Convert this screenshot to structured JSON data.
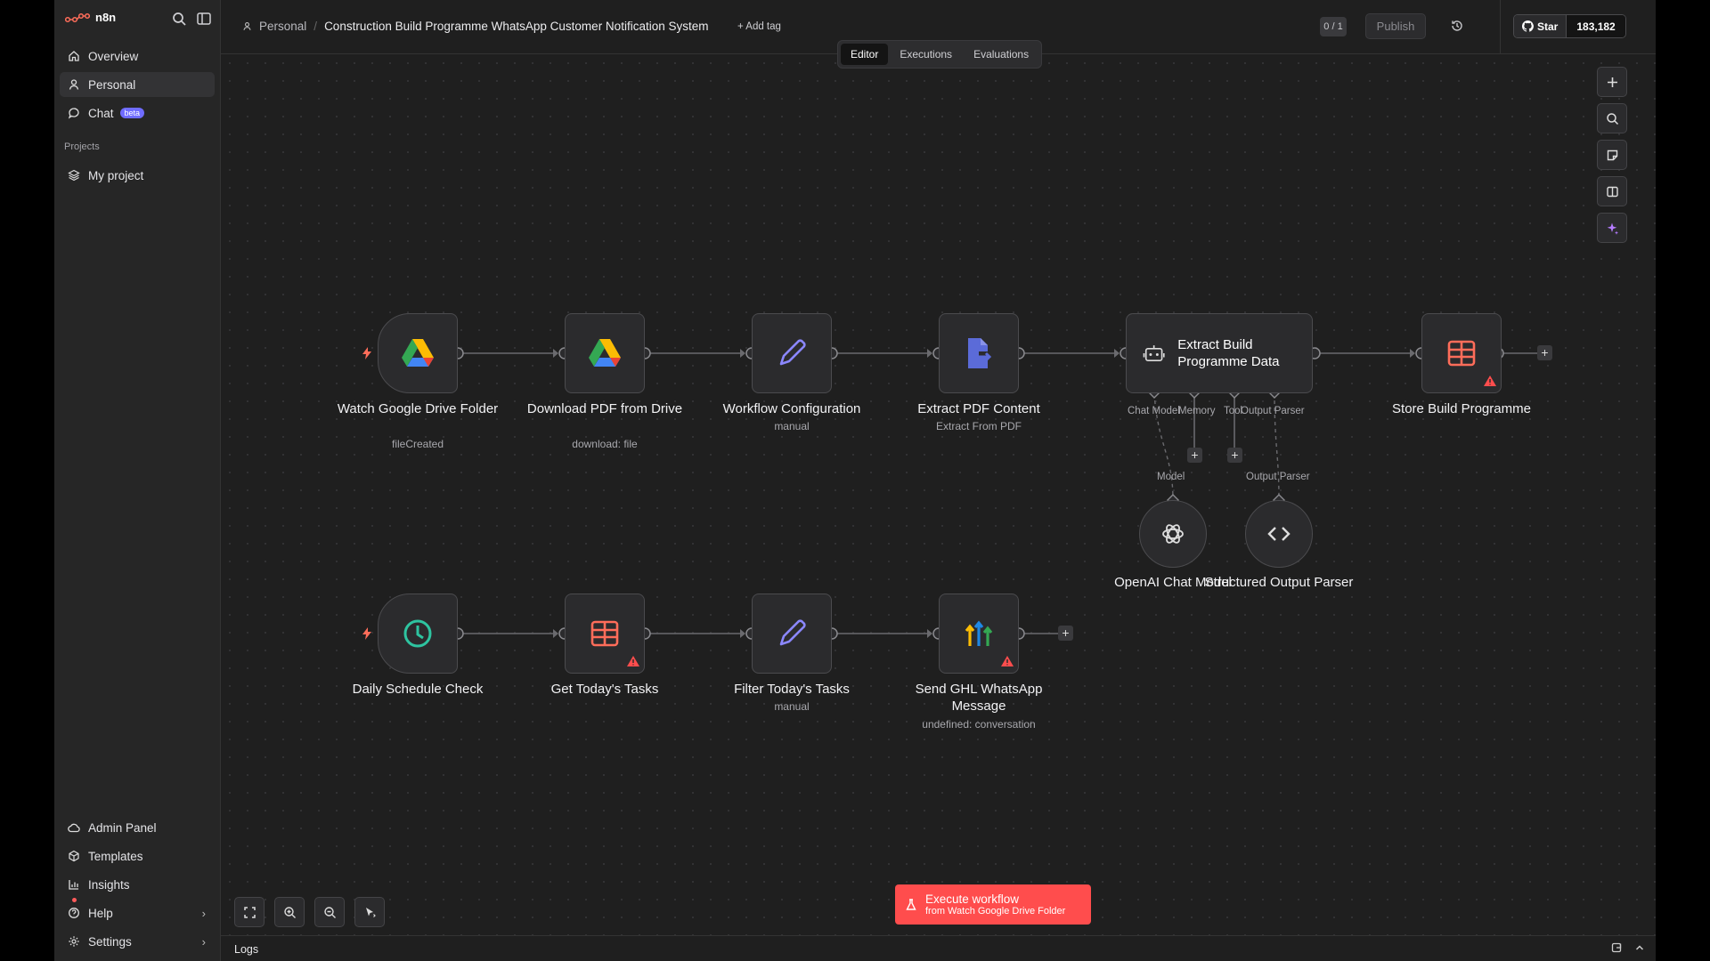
{
  "app": {
    "brand": "n8n"
  },
  "sidebar": {
    "items": [
      {
        "label": "Overview",
        "icon": "home-icon"
      },
      {
        "label": "Personal",
        "icon": "user-icon",
        "active": true
      },
      {
        "label": "Chat",
        "icon": "chat-icon",
        "badge": "beta"
      }
    ],
    "projects_label": "Projects",
    "projects": [
      {
        "label": "My project",
        "icon": "layers-icon"
      }
    ],
    "bottom_items": [
      {
        "label": "Admin Panel",
        "icon": "cloud-icon"
      },
      {
        "label": "Templates",
        "icon": "box-icon"
      },
      {
        "label": "Insights",
        "icon": "chart-icon"
      },
      {
        "label": "Help",
        "icon": "help-icon"
      },
      {
        "label": "Settings",
        "icon": "gear-icon"
      }
    ]
  },
  "header": {
    "breadcrumb_project": "Personal",
    "workflow_name": "Construction Build Programme WhatsApp Customer Notification System",
    "add_tag": "+ Add tag",
    "counter": "0 / 1",
    "publish": "Publish",
    "github_star": "Star",
    "github_count": "183,182"
  },
  "tabs": [
    {
      "label": "Editor",
      "active": true
    },
    {
      "label": "Executions"
    },
    {
      "label": "Evaluations"
    }
  ],
  "nodes": {
    "watch_drive": {
      "label": "Watch Google Drive Folder",
      "sub": "fileCreated"
    },
    "download_pdf": {
      "label": "Download PDF from Drive",
      "sub": "download: file"
    },
    "workflow_config": {
      "label": "Workflow Configuration",
      "sub": "manual"
    },
    "extract_pdf": {
      "label": "Extract PDF Content",
      "sub": "Extract From PDF"
    },
    "extract_build": {
      "label": "Extract Build Programme Data"
    },
    "store_build": {
      "label": "Store Build Programme"
    },
    "openai": {
      "label": "OpenAI Chat Model"
    },
    "structured_parser": {
      "label": "Structured Output Parser"
    },
    "daily_schedule": {
      "label": "Daily Schedule Check"
    },
    "get_tasks": {
      "label": "Get Today's Tasks"
    },
    "filter_tasks": {
      "label": "Filter Today's Tasks",
      "sub": "manual"
    },
    "send_ghl": {
      "label": "Send GHL WhatsApp Message",
      "sub": "undefined: conversation"
    }
  },
  "slots": {
    "chat_model": "Chat Model",
    "memory": "Memory",
    "tool": "Tool",
    "output_parser": "Output Parser",
    "model_label": "Model",
    "output_parser_label": "Output Parser"
  },
  "execute": {
    "title": "Execute workflow",
    "subtitle": "from Watch Google Drive Folder"
  },
  "logs": {
    "label": "Logs"
  },
  "colors": {
    "accent": "#ff4d4d",
    "edge": "#6a6a6e",
    "sheet": "#ff6d5a",
    "pencil": "#8b87ff",
    "clock": "#2ec4a0"
  }
}
